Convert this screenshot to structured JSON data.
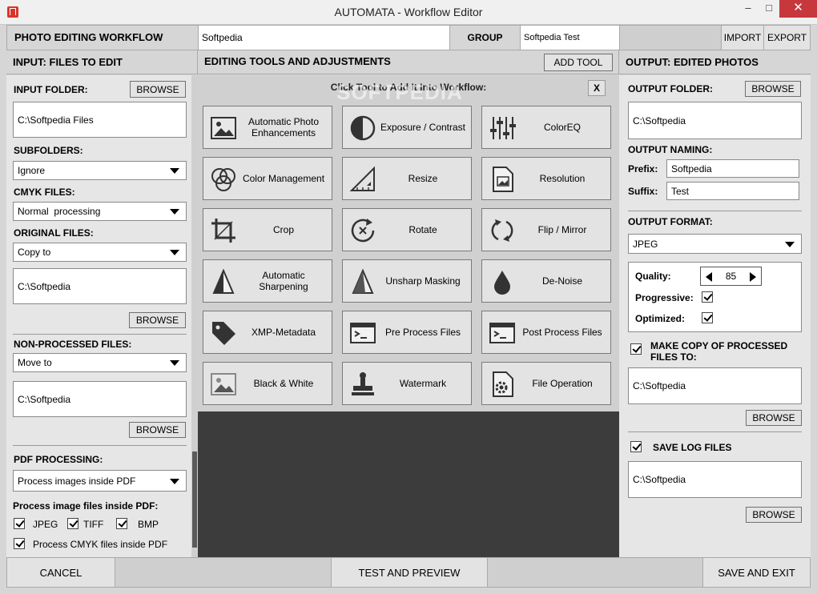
{
  "window": {
    "title": "AUTOMATA - Workflow Editor"
  },
  "header": {
    "workflow_label": "PHOTO EDITING WORKFLOW",
    "workflow_name": "Softpedia",
    "group_label": "GROUP",
    "group_value": "Softpedia Test",
    "import_label": "IMPORT",
    "export_label": "EXPORT"
  },
  "input": {
    "title": "INPUT: FILES TO EDIT",
    "folder_label": "INPUT FOLDER:",
    "browse_label": "BROWSE",
    "folder_value": "C:\\Softpedia Files",
    "subfolders_label": "SUBFOLDERS:",
    "subfolders_value": "Ignore",
    "cmyk_label": "CMYK FILES:",
    "cmyk_value": "Normal  processing",
    "original_label": "ORIGINAL FILES:",
    "original_value": "Copy to",
    "original_path": "C:\\Softpedia",
    "nonprocessed_label": "NON-PROCESSED FILES:",
    "nonprocessed_value": "Move to",
    "nonprocessed_path": "C:\\Softpedia",
    "pdf_label": "PDF PROCESSING:",
    "pdf_value": "Process images inside PDF",
    "pdf_inside_label": "Process image files inside PDF:",
    "jpeg_label": "JPEG",
    "tiff_label": "TIFF",
    "bmp_label": "BMP",
    "cmyk_pdf_label": "Process CMYK files inside PDF"
  },
  "tools": {
    "title": "EDITING TOOLS AND ADJUSTMENTS",
    "add_tool_label": "ADD TOOL",
    "hint": "Click Tool to Add It Into Workflow:",
    "close_label": "X",
    "watermark": "SOFTPEDIA",
    "items": [
      {
        "label": "Automatic Photo Enhancements",
        "icon": "photo-icon"
      },
      {
        "label": "Exposure / Contrast",
        "icon": "contrast-icon"
      },
      {
        "label": "ColorEQ",
        "icon": "equalizer-icon"
      },
      {
        "label": "Color Management",
        "icon": "color-circles-icon"
      },
      {
        "label": "Resize",
        "icon": "ruler-triangle-icon"
      },
      {
        "label": "Resolution",
        "icon": "document-image-icon"
      },
      {
        "label": "Crop",
        "icon": "crop-icon"
      },
      {
        "label": "Rotate",
        "icon": "rotate-icon"
      },
      {
        "label": "Flip / Mirror",
        "icon": "flip-icon"
      },
      {
        "label": "Automatic Sharpening",
        "icon": "sharpen-icon"
      },
      {
        "label": "Unsharp Masking",
        "icon": "unsharp-icon"
      },
      {
        "label": "De-Noise",
        "icon": "droplet-icon"
      },
      {
        "label": "XMP-Metadata",
        "icon": "tag-icon"
      },
      {
        "label": "Pre Process Files",
        "icon": "console-icon"
      },
      {
        "label": "Post Process Files",
        "icon": "console-icon"
      },
      {
        "label": "Black & White",
        "icon": "bw-photo-icon"
      },
      {
        "label": "Watermark",
        "icon": "stamp-icon"
      },
      {
        "label": "File Operation",
        "icon": "file-gear-icon"
      }
    ]
  },
  "output": {
    "title": "OUTPUT: EDITED PHOTOS",
    "folder_label": "OUTPUT FOLDER:",
    "browse_label": "BROWSE",
    "folder_value": "C:\\Softpedia",
    "naming_label": "OUTPUT NAMING:",
    "prefix_label": "Prefix:",
    "prefix_value": "Softpedia",
    "suffix_label": "Suffix:",
    "suffix_value": "Test",
    "format_label": "OUTPUT FORMAT:",
    "format_value": "JPEG",
    "quality_label": "Quality:",
    "quality_value": "85",
    "progressive_label": "Progressive:",
    "optimized_label": "Optimized:",
    "copy_label_1": "MAKE COPY OF PROCESSED",
    "copy_label_2": "FILES TO:",
    "copy_path": "C:\\Softpedia",
    "log_label": "SAVE LOG FILES",
    "log_path": "C:\\Softpedia"
  },
  "footer": {
    "cancel_label": "CANCEL",
    "test_label": "TEST AND PREVIEW",
    "save_label": "SAVE AND EXIT"
  }
}
